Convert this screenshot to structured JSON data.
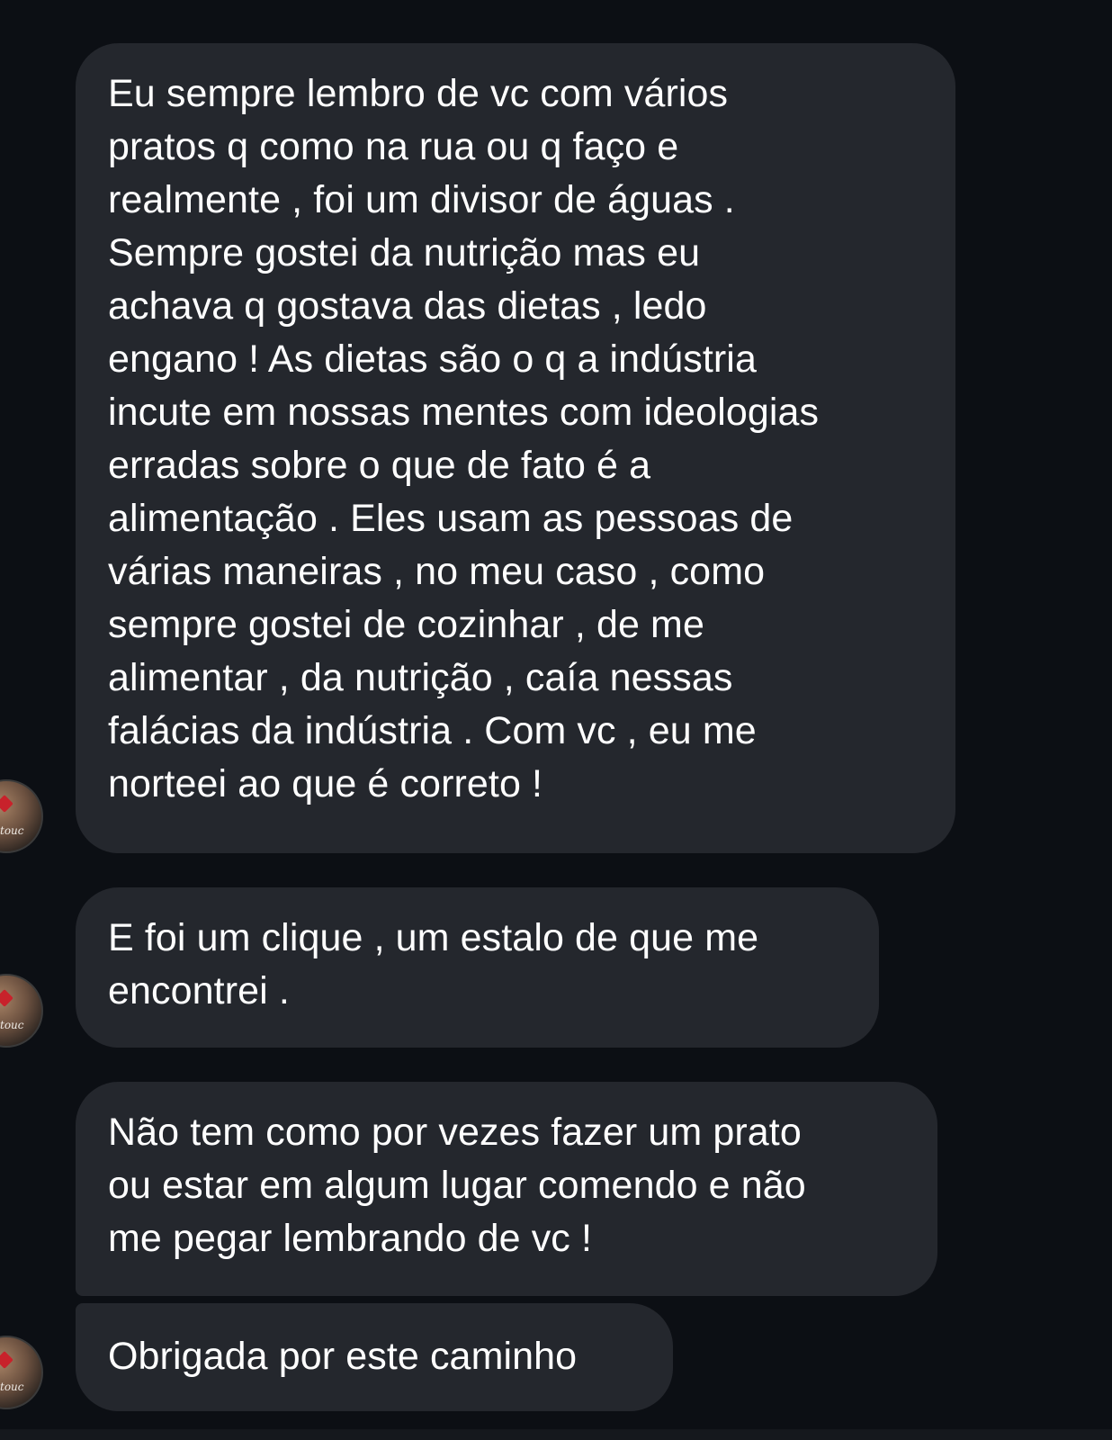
{
  "messages": [
    {
      "text": "Eu sempre lembro de vc com vários\npratos q como na rua ou q faço e\nrealmente , foi um divisor de águas  .\nSempre gostei da nutrição mas eu\nachava q gostava das dietas , ledo\nengano ! As dietas são o q a indústria\nincute em nossas mentes com ideologias\nerradas sobre o que de fato é a\nalimentação . Eles usam as pessoas de\nvárias maneiras , no meu caso , como\nsempre gostei de cozinhar , de me\nalimentar , da nutrição , caía nessas\nfalácias da indústria . Com vc , eu me\nnorteei ao que é correto !"
    },
    {
      "text": "E foi um clique , um estalo de que me\nencontrei ."
    },
    {
      "text": "Não tem como por vezes fazer um prato\nou estar em algum lugar comendo e não\nme pegar lembrando de vc !"
    },
    {
      "text": "Obrigada por este caminho"
    }
  ],
  "avatar": {
    "label": "touc",
    "icon": "profile-avatar"
  },
  "colors": {
    "background": "#0c0f14",
    "bubble": "#24272d",
    "text": "#ffffff"
  }
}
